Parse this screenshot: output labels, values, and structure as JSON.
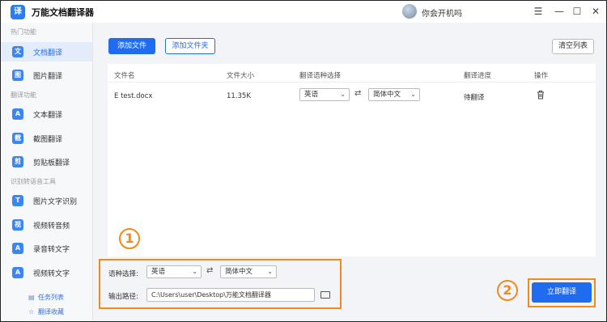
{
  "app": {
    "logo_text": "译",
    "title": "万能文档翻译器",
    "username": "你会开机吗"
  },
  "window_controls": {
    "menu": "☰",
    "minimize": "—",
    "maximize": "☐",
    "close": "✕"
  },
  "sidebar": {
    "sections": [
      {
        "title": "热门功能"
      },
      {
        "title": "翻译功能"
      },
      {
        "title": "识别转语音工具"
      }
    ],
    "items": [
      {
        "label": "文档翻译",
        "icon": "文"
      },
      {
        "label": "图片翻译",
        "icon": "图"
      },
      {
        "label": "文本翻译",
        "icon": "A"
      },
      {
        "label": "截图翻译",
        "icon": "截"
      },
      {
        "label": "剪贴板翻译",
        "icon": "剪"
      },
      {
        "label": "图片文字识别",
        "icon": "T"
      },
      {
        "label": "视频转音频",
        "icon": "视"
      },
      {
        "label": "录音转文字",
        "icon": "A"
      },
      {
        "label": "视频转文字",
        "icon": "A"
      }
    ],
    "bottom_links": [
      {
        "label": "任务列表",
        "icon": "▤"
      },
      {
        "label": "翻译收藏",
        "icon": "☆"
      }
    ]
  },
  "toolbar": {
    "add_file": "添加文件",
    "add_folder": "添加文件夹",
    "clear_list": "清空列表"
  },
  "table": {
    "headers": [
      "文件名",
      "文件大小",
      "翻译语种选择",
      "翻译进度",
      "操作"
    ],
    "rows": [
      {
        "filename": "E test.docx",
        "size": "11.35K",
        "source_lang": "英语",
        "target_lang": "简体中文",
        "progress": "待翻译"
      }
    ]
  },
  "annotations": {
    "one": "1",
    "two": "2"
  },
  "settings": {
    "lang_label": "语种选择:",
    "source_lang": "英语",
    "target_lang": "简体中文",
    "path_label": "输出路径:",
    "path_value": "C:\\Users\\user\\Desktop\\万能文档翻译器"
  },
  "translate_now": "立即翻译"
}
